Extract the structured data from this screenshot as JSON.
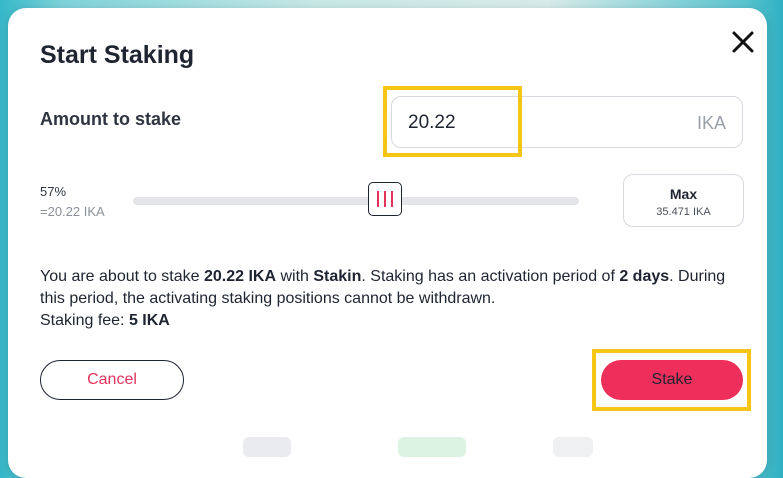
{
  "modal": {
    "title": "Start Staking",
    "close_icon": "close-icon"
  },
  "amount": {
    "label": "Amount to stake",
    "value": "20.22",
    "unit": "IKA"
  },
  "slider": {
    "percent_label": "57%",
    "equivalent_label": "=20.22 IKA",
    "level": 0.57
  },
  "max": {
    "label": "Max",
    "value": "35.471 IKA"
  },
  "info": {
    "p1": "You are about to stake ",
    "amount": "20.22 IKA",
    "p2": " with ",
    "validator": "Stakin",
    "p3": ". Staking has an activation period of ",
    "period": "2 days",
    "p4": ". During this period, the activating staking positions cannot be withdrawn.",
    "fee_label": "Staking fee: ",
    "fee_value": "5 IKA"
  },
  "actions": {
    "cancel_label": "Cancel",
    "stake_label": "Stake"
  },
  "colors": {
    "accent": "#ee2f5c",
    "highlight": "#f7c614"
  }
}
